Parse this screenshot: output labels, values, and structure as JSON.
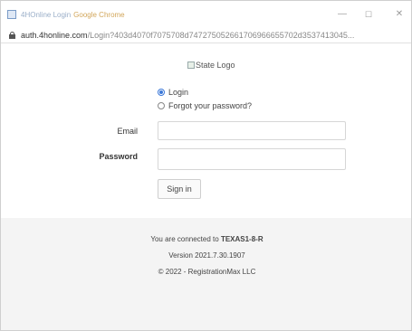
{
  "window": {
    "title_site": "4HOnline Login",
    "title_app": "Google Chrome",
    "minimize_glyph": "—",
    "maximize_glyph": "☐",
    "close_glyph": "✕"
  },
  "address_bar": {
    "icon": "lock-icon",
    "url_host": "auth.4honline.com",
    "url_path": "/Login?403d4070f7075708d747275052661706966655702d3537413045..."
  },
  "logo": {
    "icon": "broken-image-icon",
    "alt_text": "State Logo"
  },
  "login_options": {
    "login_label": "Login",
    "forgot_label": "Forgot your password?",
    "selected": "login"
  },
  "form": {
    "email_label": "Email",
    "email_value": "",
    "password_label": "Password",
    "password_value": "",
    "signin_label": "Sign in"
  },
  "footer": {
    "connected_prefix": "You are connected to",
    "connected_server": "TEXAS1-8-R",
    "version": "Version 2021.7.30.1907",
    "copyright": "© 2022 - RegistrationMax LLC"
  },
  "colors": {
    "accent": "#3b78d8",
    "footer_bg": "#f4f4f4"
  }
}
